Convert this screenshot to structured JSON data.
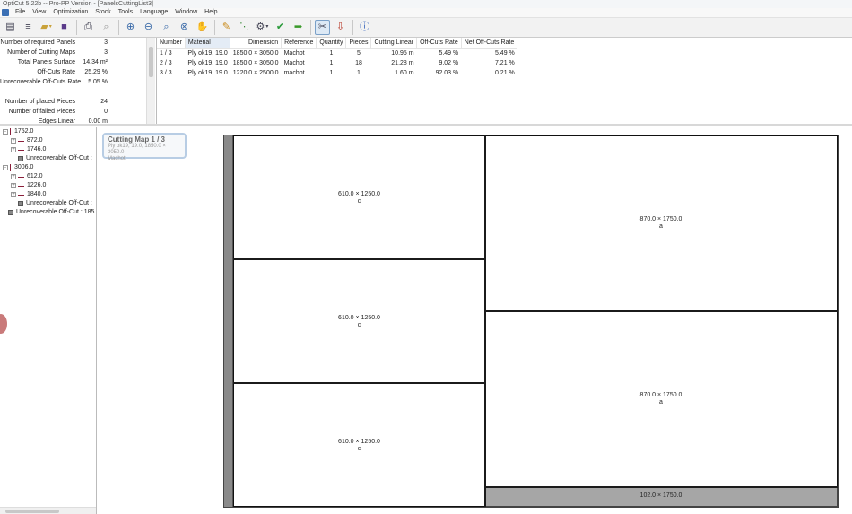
{
  "window": {
    "title": "OptiCut 5.22b -- Pro-PP Version - [PanelsCuttingList3]"
  },
  "menu": [
    "File",
    "View",
    "Optimization",
    "Stock",
    "Tools",
    "Language",
    "Window",
    "Help"
  ],
  "stats": [
    {
      "label": "Number of required Panels",
      "value": "3"
    },
    {
      "label": "Number of Cutting Maps",
      "value": "3"
    },
    {
      "label": "Total Panels Surface",
      "value": "14.34 m²"
    },
    {
      "label": "Off-Cuts Rate",
      "value": "25.29 %"
    },
    {
      "label": "Unrecoverable Off-Cuts Rate",
      "value": "5.05 %"
    },
    {
      "label": "",
      "value": ""
    },
    {
      "label": "Number of placed Pieces",
      "value": "24"
    },
    {
      "label": "Number of failed Pieces",
      "value": "0"
    },
    {
      "label": "Edges Linear",
      "value": "0.00 m"
    }
  ],
  "table": {
    "headers": [
      "Number",
      "Material",
      "Dimension",
      "Reference",
      "Quantity",
      "Pieces",
      "Cutting Linear",
      "Off-Cuts Rate",
      "Net Off-Cuts Rate"
    ],
    "rows": [
      [
        "1 / 3",
        "Ply ok19, 19.0",
        "1850.0 × 3050.0",
        "Machot",
        "1",
        "5",
        "10.95 m",
        "5.49 %",
        "5.49 %"
      ],
      [
        "2 / 3",
        "Ply ok19, 19.0",
        "1850.0 × 3050.0",
        "Machot",
        "1",
        "18",
        "21.28 m",
        "9.02 %",
        "7.21 %"
      ],
      [
        "3 / 3",
        "Ply ok19, 19.0",
        "1220.0 × 2500.0",
        "machot",
        "1",
        "1",
        "1.60 m",
        "92.03 %",
        "0.21 %"
      ]
    ]
  },
  "tree": [
    {
      "label": "1752.0",
      "level": 0,
      "kind": "bar",
      "expander": "-"
    },
    {
      "label": "872.0",
      "level": 1,
      "kind": "hbar",
      "expander": "+"
    },
    {
      "label": "1746.0",
      "level": 1,
      "kind": "hbar",
      "expander": "+"
    },
    {
      "label": "Unrecoverable Off-Cut :",
      "level": 1,
      "kind": "square",
      "expander": ""
    },
    {
      "label": "3006.0",
      "level": 0,
      "kind": "bar",
      "expander": "-"
    },
    {
      "label": "612.0",
      "level": 1,
      "kind": "hbar",
      "expander": "+"
    },
    {
      "label": "1226.0",
      "level": 1,
      "kind": "hbar",
      "expander": "+"
    },
    {
      "label": "1840.0",
      "level": 1,
      "kind": "hbar",
      "expander": "+"
    },
    {
      "label": "Unrecoverable Off-Cut :",
      "level": 1,
      "kind": "square",
      "expander": ""
    },
    {
      "label": "Unrecoverable Off-Cut : 185",
      "level": 0,
      "kind": "square",
      "expander": ""
    }
  ],
  "map": {
    "label_title": "Cutting Map 1 / 3",
    "label_material": "Ply ok19, 19.0, 1850.0 × 3050.0",
    "label_reference": "Machot",
    "pieces": [
      {
        "dim": "610.0 × 1250.0",
        "ref": "c"
      },
      {
        "dim": "610.0 × 1250.0",
        "ref": "c"
      },
      {
        "dim": "610.0 × 1250.0",
        "ref": "c"
      },
      {
        "dim": "870.0 × 1750.0",
        "ref": "a"
      },
      {
        "dim": "870.0 × 1750.0",
        "ref": "a"
      }
    ],
    "offcut": {
      "dim": "102.0 × 1750.0"
    }
  }
}
